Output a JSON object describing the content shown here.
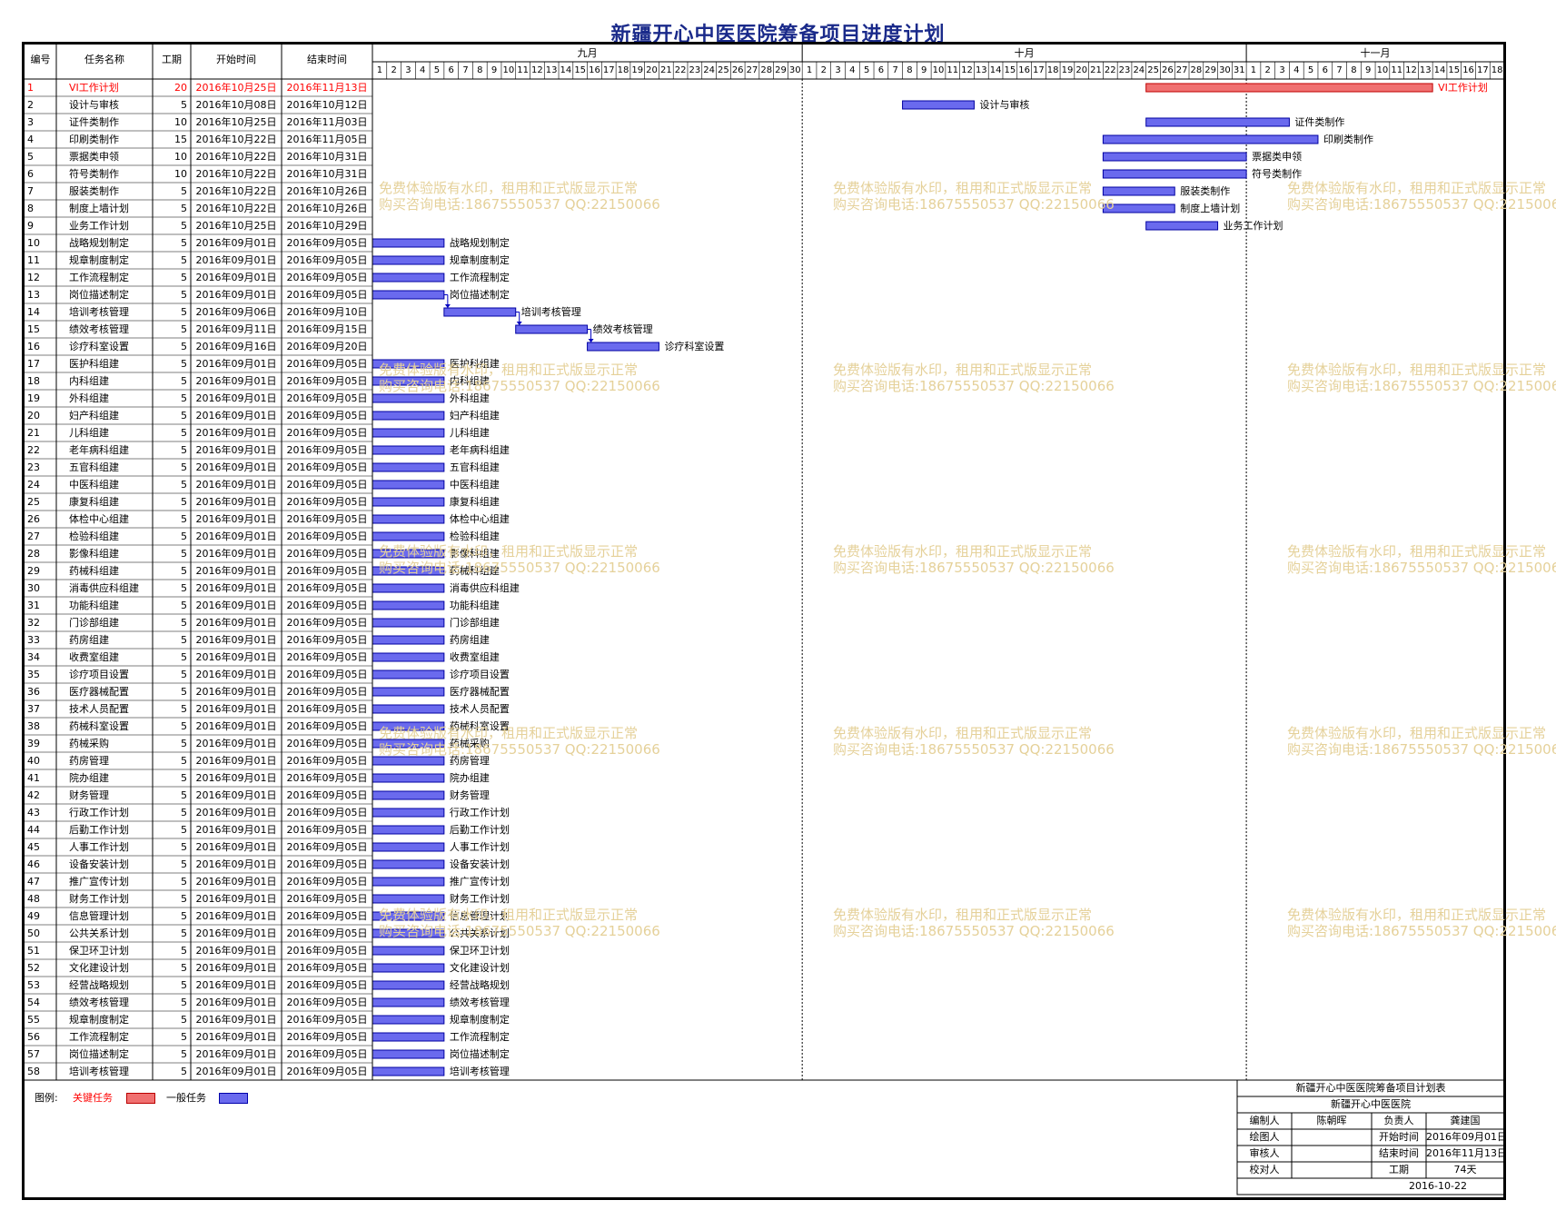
{
  "title": "新疆开心中医医院筹备项目进度计划",
  "headers": {
    "no": "编号",
    "name": "任务名称",
    "dur": "工期",
    "start": "开始时间",
    "end": "结束时间"
  },
  "months": [
    {
      "label": "九月",
      "days": 30
    },
    {
      "label": "十月",
      "days": 31
    },
    {
      "label": "十一月",
      "days": 18
    }
  ],
  "timeline_start": "2016-09-01",
  "colors": {
    "critical": "#f07070",
    "normal": "#6a6aee",
    "critical_text": "#ff0000",
    "title": "#1a2a8a",
    "watermark": "#e5d19a"
  },
  "tasks": [
    {
      "no": "1",
      "name": "VI工作计划",
      "dur": "20",
      "start": "2016年10月25日",
      "end": "2016年11月13日",
      "critical": true,
      "s": "2016-10-25",
      "e": "2016-11-13"
    },
    {
      "no": "2",
      "name": "设计与审核",
      "dur": "5",
      "start": "2016年10月08日",
      "end": "2016年10月12日",
      "s": "2016-10-08",
      "e": "2016-10-12"
    },
    {
      "no": "3",
      "name": "证件类制作",
      "dur": "10",
      "start": "2016年10月25日",
      "end": "2016年11月03日",
      "s": "2016-10-25",
      "e": "2016-11-03"
    },
    {
      "no": "4",
      "name": "印刷类制作",
      "dur": "15",
      "start": "2016年10月22日",
      "end": "2016年11月05日",
      "s": "2016-10-22",
      "e": "2016-11-05"
    },
    {
      "no": "5",
      "name": "票据类申领",
      "dur": "10",
      "start": "2016年10月22日",
      "end": "2016年10月31日",
      "s": "2016-10-22",
      "e": "2016-10-31"
    },
    {
      "no": "6",
      "name": "符号类制作",
      "dur": "10",
      "start": "2016年10月22日",
      "end": "2016年10月31日",
      "s": "2016-10-22",
      "e": "2016-10-31"
    },
    {
      "no": "7",
      "name": "服装类制作",
      "dur": "5",
      "start": "2016年10月22日",
      "end": "2016年10月26日",
      "s": "2016-10-22",
      "e": "2016-10-26"
    },
    {
      "no": "8",
      "name": "制度上墙计划",
      "dur": "5",
      "start": "2016年10月22日",
      "end": "2016年10月26日",
      "s": "2016-10-22",
      "e": "2016-10-26"
    },
    {
      "no": "9",
      "name": "业务工作计划",
      "dur": "5",
      "start": "2016年10月25日",
      "end": "2016年10月29日",
      "s": "2016-10-25",
      "e": "2016-10-29"
    },
    {
      "no": "10",
      "name": "战略规划制定",
      "dur": "5",
      "start": "2016年09月01日",
      "end": "2016年09月05日",
      "s": "2016-09-01",
      "e": "2016-09-05"
    },
    {
      "no": "11",
      "name": "规章制度制定",
      "dur": "5",
      "start": "2016年09月01日",
      "end": "2016年09月05日",
      "s": "2016-09-01",
      "e": "2016-09-05"
    },
    {
      "no": "12",
      "name": "工作流程制定",
      "dur": "5",
      "start": "2016年09月01日",
      "end": "2016年09月05日",
      "s": "2016-09-01",
      "e": "2016-09-05"
    },
    {
      "no": "13",
      "name": "岗位描述制定",
      "dur": "5",
      "start": "2016年09月01日",
      "end": "2016年09月05日",
      "s": "2016-09-01",
      "e": "2016-09-05"
    },
    {
      "no": "14",
      "name": "培训考核管理",
      "dur": "5",
      "start": "2016年09月06日",
      "end": "2016年09月10日",
      "s": "2016-09-06",
      "e": "2016-09-10"
    },
    {
      "no": "15",
      "name": "绩效考核管理",
      "dur": "5",
      "start": "2016年09月11日",
      "end": "2016年09月15日",
      "s": "2016-09-11",
      "e": "2016-09-15"
    },
    {
      "no": "16",
      "name": "诊疗科室设置",
      "dur": "5",
      "start": "2016年09月16日",
      "end": "2016年09月20日",
      "s": "2016-09-16",
      "e": "2016-09-20"
    },
    {
      "no": "17",
      "name": "医护科组建",
      "dur": "5",
      "start": "2016年09月01日",
      "end": "2016年09月05日",
      "s": "2016-09-01",
      "e": "2016-09-05"
    },
    {
      "no": "18",
      "name": "内科组建",
      "dur": "5",
      "start": "2016年09月01日",
      "end": "2016年09月05日",
      "s": "2016-09-01",
      "e": "2016-09-05"
    },
    {
      "no": "19",
      "name": "外科组建",
      "dur": "5",
      "start": "2016年09月01日",
      "end": "2016年09月05日",
      "s": "2016-09-01",
      "e": "2016-09-05"
    },
    {
      "no": "20",
      "name": "妇产科组建",
      "dur": "5",
      "start": "2016年09月01日",
      "end": "2016年09月05日",
      "s": "2016-09-01",
      "e": "2016-09-05"
    },
    {
      "no": "21",
      "name": "儿科组建",
      "dur": "5",
      "start": "2016年09月01日",
      "end": "2016年09月05日",
      "s": "2016-09-01",
      "e": "2016-09-05"
    },
    {
      "no": "22",
      "name": "老年病科组建",
      "dur": "5",
      "start": "2016年09月01日",
      "end": "2016年09月05日",
      "s": "2016-09-01",
      "e": "2016-09-05"
    },
    {
      "no": "23",
      "name": "五官科组建",
      "dur": "5",
      "start": "2016年09月01日",
      "end": "2016年09月05日",
      "s": "2016-09-01",
      "e": "2016-09-05"
    },
    {
      "no": "24",
      "name": "中医科组建",
      "dur": "5",
      "start": "2016年09月01日",
      "end": "2016年09月05日",
      "s": "2016-09-01",
      "e": "2016-09-05"
    },
    {
      "no": "25",
      "name": "康复科组建",
      "dur": "5",
      "start": "2016年09月01日",
      "end": "2016年09月05日",
      "s": "2016-09-01",
      "e": "2016-09-05"
    },
    {
      "no": "26",
      "name": "体检中心组建",
      "dur": "5",
      "start": "2016年09月01日",
      "end": "2016年09月05日",
      "s": "2016-09-01",
      "e": "2016-09-05"
    },
    {
      "no": "27",
      "name": "检验科组建",
      "dur": "5",
      "start": "2016年09月01日",
      "end": "2016年09月05日",
      "s": "2016-09-01",
      "e": "2016-09-05"
    },
    {
      "no": "28",
      "name": "影像科组建",
      "dur": "5",
      "start": "2016年09月01日",
      "end": "2016年09月05日",
      "s": "2016-09-01",
      "e": "2016-09-05"
    },
    {
      "no": "29",
      "name": "药械科组建",
      "dur": "5",
      "start": "2016年09月01日",
      "end": "2016年09月05日",
      "s": "2016-09-01",
      "e": "2016-09-05"
    },
    {
      "no": "30",
      "name": "消毒供应科组建",
      "dur": "5",
      "start": "2016年09月01日",
      "end": "2016年09月05日",
      "s": "2016-09-01",
      "e": "2016-09-05"
    },
    {
      "no": "31",
      "name": "功能科组建",
      "dur": "5",
      "start": "2016年09月01日",
      "end": "2016年09月05日",
      "s": "2016-09-01",
      "e": "2016-09-05"
    },
    {
      "no": "32",
      "name": "门诊部组建",
      "dur": "5",
      "start": "2016年09月01日",
      "end": "2016年09月05日",
      "s": "2016-09-01",
      "e": "2016-09-05"
    },
    {
      "no": "33",
      "name": "药房组建",
      "dur": "5",
      "start": "2016年09月01日",
      "end": "2016年09月05日",
      "s": "2016-09-01",
      "e": "2016-09-05"
    },
    {
      "no": "34",
      "name": "收费室组建",
      "dur": "5",
      "start": "2016年09月01日",
      "end": "2016年09月05日",
      "s": "2016-09-01",
      "e": "2016-09-05"
    },
    {
      "no": "35",
      "name": "诊疗项目设置",
      "dur": "5",
      "start": "2016年09月01日",
      "end": "2016年09月05日",
      "s": "2016-09-01",
      "e": "2016-09-05"
    },
    {
      "no": "36",
      "name": "医疗器械配置",
      "dur": "5",
      "start": "2016年09月01日",
      "end": "2016年09月05日",
      "s": "2016-09-01",
      "e": "2016-09-05"
    },
    {
      "no": "37",
      "name": "技术人员配置",
      "dur": "5",
      "start": "2016年09月01日",
      "end": "2016年09月05日",
      "s": "2016-09-01",
      "e": "2016-09-05"
    },
    {
      "no": "38",
      "name": "药械科室设置",
      "dur": "5",
      "start": "2016年09月01日",
      "end": "2016年09月05日",
      "s": "2016-09-01",
      "e": "2016-09-05"
    },
    {
      "no": "39",
      "name": "药械采购",
      "dur": "5",
      "start": "2016年09月01日",
      "end": "2016年09月05日",
      "s": "2016-09-01",
      "e": "2016-09-05"
    },
    {
      "no": "40",
      "name": "药房管理",
      "dur": "5",
      "start": "2016年09月01日",
      "end": "2016年09月05日",
      "s": "2016-09-01",
      "e": "2016-09-05"
    },
    {
      "no": "41",
      "name": "院办组建",
      "dur": "5",
      "start": "2016年09月01日",
      "end": "2016年09月05日",
      "s": "2016-09-01",
      "e": "2016-09-05"
    },
    {
      "no": "42",
      "name": "财务管理",
      "dur": "5",
      "start": "2016年09月01日",
      "end": "2016年09月05日",
      "s": "2016-09-01",
      "e": "2016-09-05"
    },
    {
      "no": "43",
      "name": "行政工作计划",
      "dur": "5",
      "start": "2016年09月01日",
      "end": "2016年09月05日",
      "s": "2016-09-01",
      "e": "2016-09-05"
    },
    {
      "no": "44",
      "name": "后勤工作计划",
      "dur": "5",
      "start": "2016年09月01日",
      "end": "2016年09月05日",
      "s": "2016-09-01",
      "e": "2016-09-05"
    },
    {
      "no": "45",
      "name": "人事工作计划",
      "dur": "5",
      "start": "2016年09月01日",
      "end": "2016年09月05日",
      "s": "2016-09-01",
      "e": "2016-09-05"
    },
    {
      "no": "46",
      "name": "设备安装计划",
      "dur": "5",
      "start": "2016年09月01日",
      "end": "2016年09月05日",
      "s": "2016-09-01",
      "e": "2016-09-05"
    },
    {
      "no": "47",
      "name": "推广宣传计划",
      "dur": "5",
      "start": "2016年09月01日",
      "end": "2016年09月05日",
      "s": "2016-09-01",
      "e": "2016-09-05"
    },
    {
      "no": "48",
      "name": "财务工作计划",
      "dur": "5",
      "start": "2016年09月01日",
      "end": "2016年09月05日",
      "s": "2016-09-01",
      "e": "2016-09-05"
    },
    {
      "no": "49",
      "name": "信息管理计划",
      "dur": "5",
      "start": "2016年09月01日",
      "end": "2016年09月05日",
      "s": "2016-09-01",
      "e": "2016-09-05"
    },
    {
      "no": "50",
      "name": "公共关系计划",
      "dur": "5",
      "start": "2016年09月01日",
      "end": "2016年09月05日",
      "s": "2016-09-01",
      "e": "2016-09-05"
    },
    {
      "no": "51",
      "name": "保卫环卫计划",
      "dur": "5",
      "start": "2016年09月01日",
      "end": "2016年09月05日",
      "s": "2016-09-01",
      "e": "2016-09-05"
    },
    {
      "no": "52",
      "name": "文化建设计划",
      "dur": "5",
      "start": "2016年09月01日",
      "end": "2016年09月05日",
      "s": "2016-09-01",
      "e": "2016-09-05"
    },
    {
      "no": "53",
      "name": "经营战略规划",
      "dur": "5",
      "start": "2016年09月01日",
      "end": "2016年09月05日",
      "s": "2016-09-01",
      "e": "2016-09-05"
    },
    {
      "no": "54",
      "name": "绩效考核管理",
      "dur": "5",
      "start": "2016年09月01日",
      "end": "2016年09月05日",
      "s": "2016-09-01",
      "e": "2016-09-05"
    },
    {
      "no": "55",
      "name": "规章制度制定",
      "dur": "5",
      "start": "2016年09月01日",
      "end": "2016年09月05日",
      "s": "2016-09-01",
      "e": "2016-09-05"
    },
    {
      "no": "56",
      "name": "工作流程制定",
      "dur": "5",
      "start": "2016年09月01日",
      "end": "2016年09月05日",
      "s": "2016-09-01",
      "e": "2016-09-05"
    },
    {
      "no": "57",
      "name": "岗位描述制定",
      "dur": "5",
      "start": "2016年09月01日",
      "end": "2016年09月05日",
      "s": "2016-09-01",
      "e": "2016-09-05"
    },
    {
      "no": "58",
      "name": "培训考核管理",
      "dur": "5",
      "start": "2016年09月01日",
      "end": "2016年09月05日",
      "s": "2016-09-01",
      "e": "2016-09-05"
    }
  ],
  "dependencies": [
    [
      13,
      14
    ],
    [
      14,
      15
    ],
    [
      15,
      16
    ]
  ],
  "legend": {
    "prefix": "图例:",
    "critical": "关键任务",
    "normal": "一般任务"
  },
  "watermark": {
    "line1": "免费体验版有水印，租用和正式版显示正常",
    "line2": "购买咨询电话:18675550537 QQ:22150066"
  },
  "title_block": {
    "title": "新疆开心中医医院筹备项目计划表",
    "org": "新疆开心中医医院",
    "rows": [
      [
        "编制人",
        "陈朝晖",
        "负责人",
        "龚建国"
      ],
      [
        "绘图人",
        "",
        "开始时间",
        "2016年09月01日"
      ],
      [
        "审核人",
        "",
        "结束时间",
        "2016年11月13日"
      ],
      [
        "校对人",
        "",
        "工期",
        "74天"
      ]
    ],
    "date": "2016-10-22"
  }
}
